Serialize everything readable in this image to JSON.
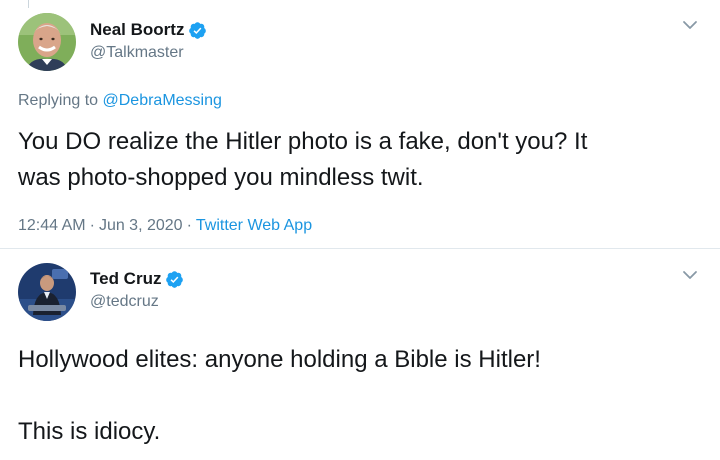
{
  "tweets": [
    {
      "display_name": "Neal Boortz",
      "handle": "@Talkmaster",
      "verified": true,
      "avatar_icon": "avatar-photo-neal-boortz",
      "reply_prefix": "Replying to",
      "reply_to": "@DebraMessing",
      "text": "You DO realize the Hitler photo is a fake, don't you?  It\nwas photo-shopped you mindless twit.",
      "time": "12:44 AM",
      "separator": "·",
      "date": "Jun 3, 2020",
      "source": "Twitter Web App"
    },
    {
      "display_name": "Ted Cruz",
      "handle": "@tedcruz",
      "verified": true,
      "avatar_icon": "avatar-photo-ted-cruz",
      "text": "Hollywood elites:  anyone holding a Bible is Hitler!\n\nThis is idiocy."
    }
  ],
  "colors": {
    "name": "#14171a",
    "secondary": "#657786",
    "link": "#1b95e0",
    "verified_badge": "#1da1f2",
    "divider": "#e1e8ed"
  },
  "icons": {
    "verified": "verified-badge-icon",
    "menu": "chevron-down-icon"
  }
}
